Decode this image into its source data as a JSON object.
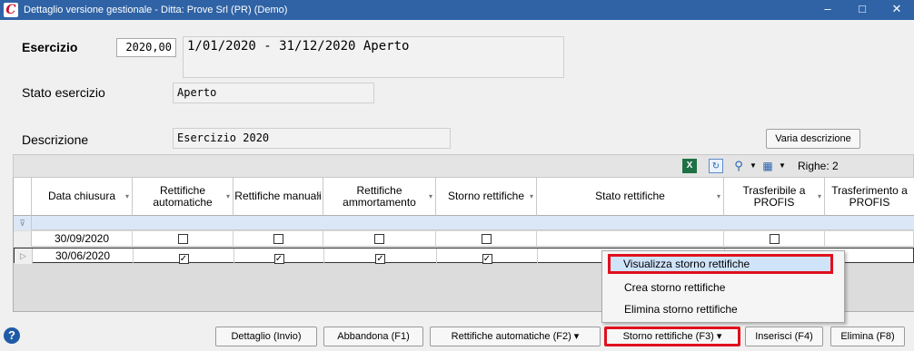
{
  "window": {
    "title": "Dettaglio versione gestionale - Ditta: Prove Srl (PR)  (Demo)",
    "minimize": "–",
    "maximize": "□",
    "close": "✕"
  },
  "form": {
    "esercizio_label": "Esercizio",
    "esercizio_value": "2020,00",
    "esercizio_range": "1/01/2020 - 31/12/2020 Aperto",
    "stato_label": "Stato esercizio",
    "stato_value": "Aperto",
    "descrizione_label": "Descrizione",
    "descrizione_value": "Esercizio 2020",
    "varia_button": "Varia descrizione"
  },
  "toolbar": {
    "righe": "Righe: 2"
  },
  "grid": {
    "columns": [
      "Data chiusura",
      "Rettifiche automatiche",
      "Rettifiche manuali",
      "Rettifiche ammortamento",
      "Storno rettifiche",
      "Stato rettifiche",
      "Trasferibile a PROFIS",
      "Trasferimento a PROFIS"
    ],
    "rows": [
      {
        "date": "30/09/2020",
        "auto": false,
        "manuali": false,
        "ammortamento": false,
        "storno": false,
        "trasferibile": false
      },
      {
        "date": "30/06/2020",
        "auto": true,
        "manuali": true,
        "ammortamento": true,
        "storno": true,
        "trasferibile": false
      }
    ]
  },
  "context_menu": {
    "items": [
      "Visualizza storno rettifiche",
      "Crea storno rettifiche",
      "Elimina storno rettifiche"
    ]
  },
  "buttons": {
    "dettaglio": "Dettaglio (Invio)",
    "abbandona": "Abbandona (F1)",
    "rettifiche_auto": "Rettifiche automatiche (F2) ▾",
    "storno": "Storno rettifiche (F3) ▾",
    "inserisci": "Inserisci (F4)",
    "elimina": "Elimina (F8)"
  },
  "icons": {
    "help": "?",
    "app_logo": "C",
    "filter": "⊽",
    "row_indicator": "▷"
  }
}
